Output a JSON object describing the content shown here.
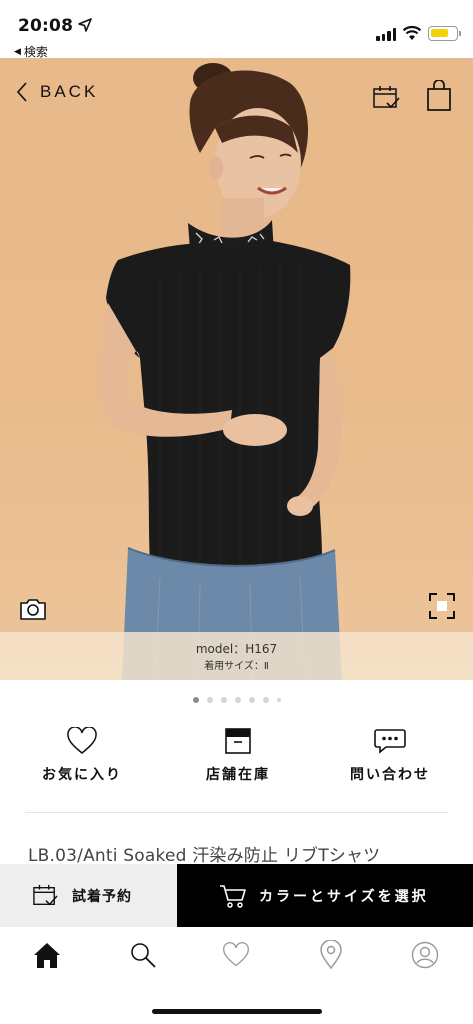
{
  "status_bar": {
    "time": "20:08",
    "back_app_label": "検索"
  },
  "header": {
    "back_label": "BACK",
    "calendar_icon": "calendar-check-icon",
    "bag_icon": "shopping-bag-icon"
  },
  "hero": {
    "model_label": "model：",
    "model_height": "H167",
    "model_size": "着用サイズ：Ⅱ",
    "camera_icon": "camera-icon",
    "expand_icon": "expand-icon"
  },
  "pagination": {
    "total": 7,
    "active_index": 0
  },
  "actions": [
    {
      "label": "お気に入り",
      "icon": "heart-icon"
    },
    {
      "label": "店舗在庫",
      "icon": "box-icon"
    },
    {
      "label": "問い合わせ",
      "icon": "chat-bubble-icon"
    }
  ],
  "product": {
    "title": "LB.03/Anti Soaked 汗染み防止 リブTシャツ"
  },
  "bottom_buttons": {
    "reserve_label": "試着予約",
    "select_label": "カラーとサイズを選択"
  },
  "tabbar": [
    {
      "name": "home",
      "icon": "home-icon",
      "active": true
    },
    {
      "name": "search",
      "icon": "search-icon",
      "active": false
    },
    {
      "name": "favorites",
      "icon": "heart-icon",
      "active": false
    },
    {
      "name": "stores",
      "icon": "location-pin-icon",
      "active": false
    },
    {
      "name": "account",
      "icon": "user-icon",
      "active": false
    }
  ],
  "colors": {
    "accent": "#000000",
    "background_photo": "#e9bb8c",
    "battery": "#f4d20a"
  }
}
